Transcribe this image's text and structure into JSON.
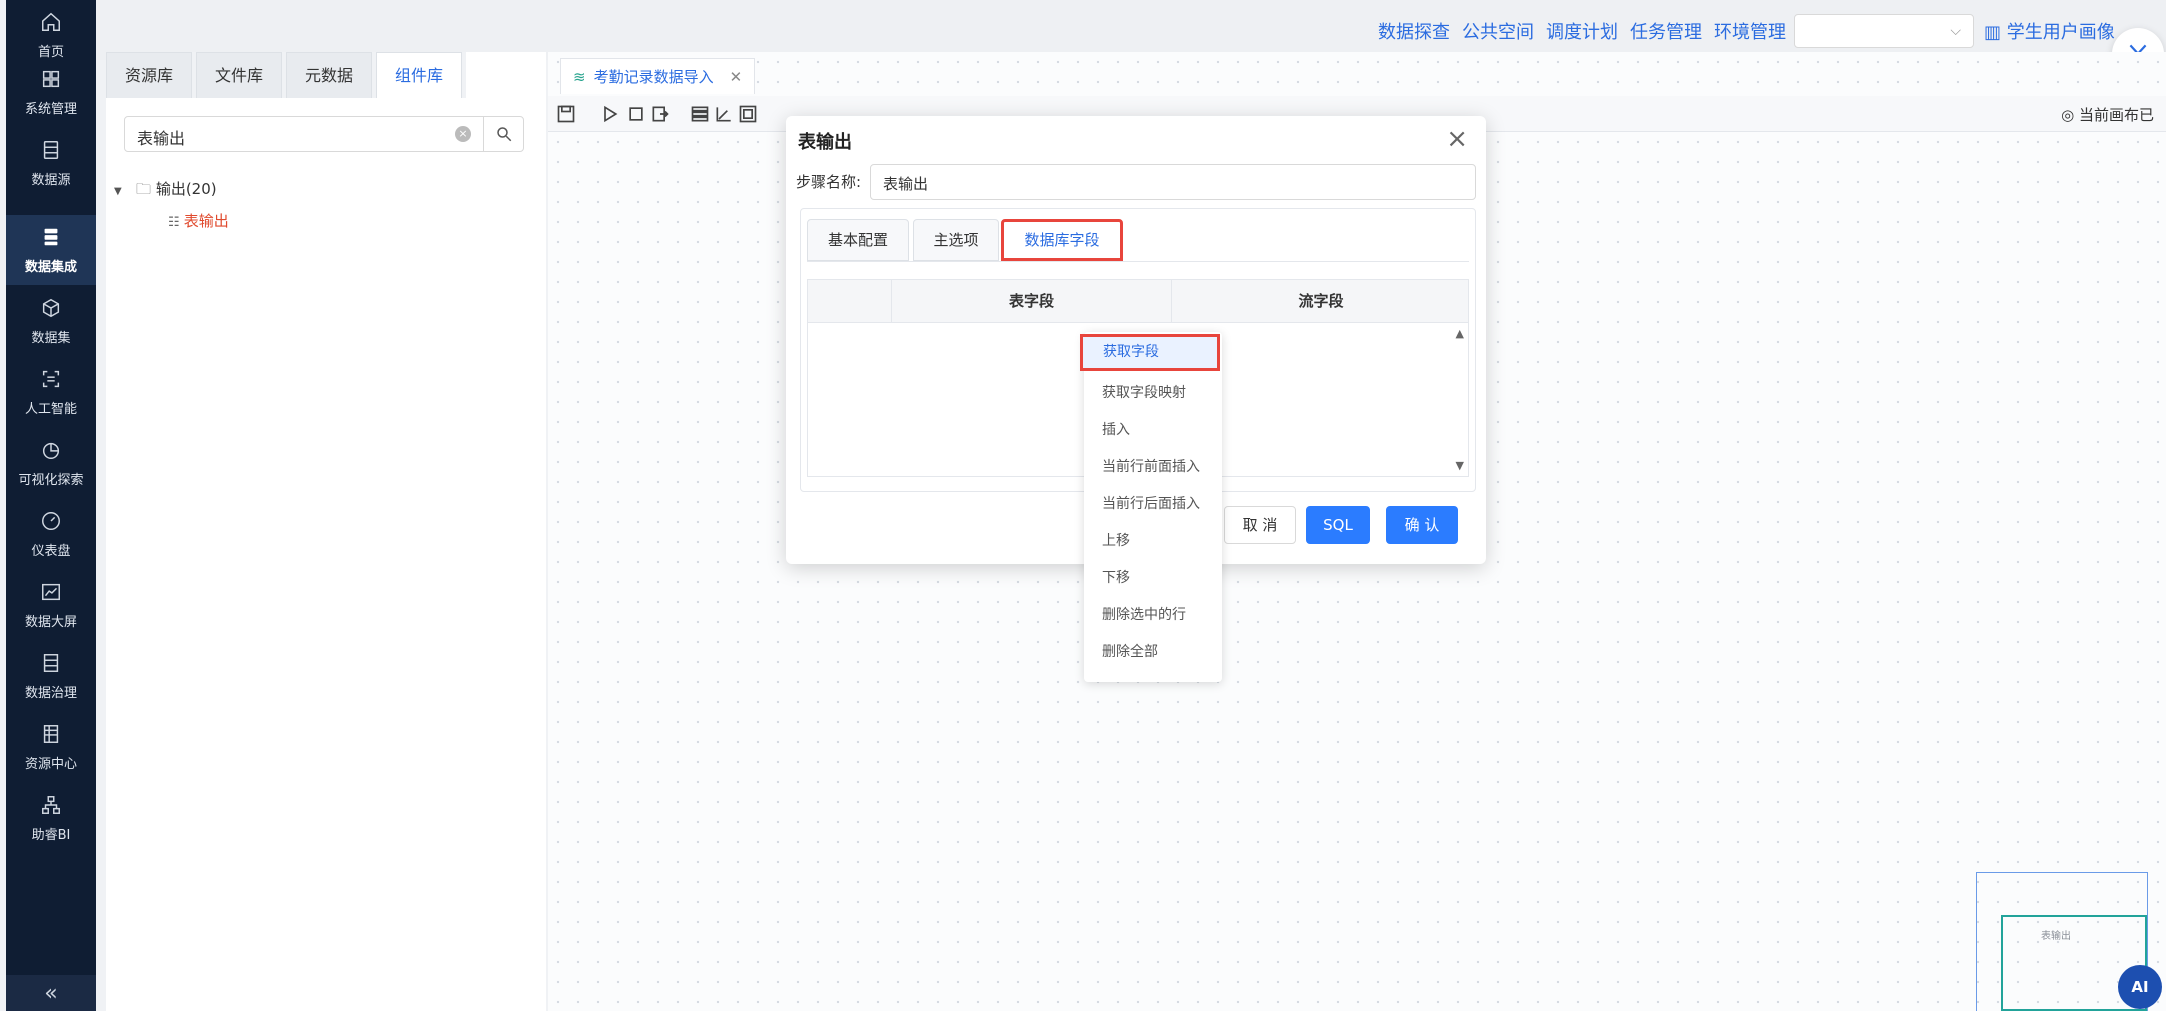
{
  "nav": {
    "items": [
      {
        "label": "首页",
        "icon": "home-icon"
      },
      {
        "label": "系统管理",
        "icon": "grid-icon"
      },
      {
        "label": "数据源",
        "icon": "database-icon"
      },
      {
        "label": "数据集成",
        "icon": "server-icon",
        "active": true
      },
      {
        "label": "数据集",
        "icon": "cube-icon"
      },
      {
        "label": "人工智能",
        "icon": "ai-scan-icon"
      },
      {
        "label": "可视化探索",
        "icon": "pie-chart-icon"
      },
      {
        "label": "仪表盘",
        "icon": "gauge-icon"
      },
      {
        "label": "数据大屏",
        "icon": "line-chart-icon"
      },
      {
        "label": "数据治理",
        "icon": "list-icon"
      },
      {
        "label": "资源中心",
        "icon": "folder-table-icon"
      },
      {
        "label": "助睿BI",
        "icon": "org-chart-icon"
      }
    ],
    "collapse_label": "«"
  },
  "topbar": {
    "links": [
      "数据探查",
      "公共空间",
      "调度计划",
      "任务管理",
      "环境管理"
    ],
    "select_value": "",
    "user_label": "学生用户画像"
  },
  "leftpanel": {
    "tabs": [
      "资源库",
      "文件库",
      "元数据",
      "组件库"
    ],
    "active_tab": "组件库",
    "search_value": "表输出",
    "tree": {
      "folder": "输出(20)",
      "leaf": "表输出"
    }
  },
  "canvas": {
    "file_tab": "考勤记录数据导入",
    "status": "当前画布已",
    "minimap_node": "表输出"
  },
  "dialog": {
    "title": "表输出",
    "step_label": "步骤名称:",
    "step_value": "表输出",
    "tabs": [
      "基本配置",
      "主选项",
      "数据库字段"
    ],
    "active_tab": "数据库字段",
    "columns": [
      "表字段",
      "流字段"
    ],
    "buttons": {
      "cancel": "取 消",
      "sql": "SQL",
      "ok": "确 认"
    }
  },
  "context_menu": {
    "items": [
      "获取字段",
      "获取字段映射",
      "插入",
      "当前行前面插入",
      "当前行后面插入",
      "上移",
      "下移",
      "删除选中的行",
      "删除全部"
    ],
    "highlighted": "获取字段"
  },
  "float": {
    "ai_label": "AI"
  },
  "colors": {
    "nav_bg": "#0f1d33",
    "accent": "#2b6ce0",
    "highlight_border": "#e8453c",
    "primary_btn": "#2b7cff"
  }
}
